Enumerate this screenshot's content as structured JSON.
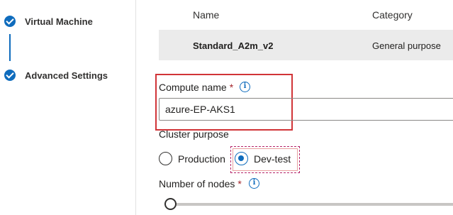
{
  "wizard": {
    "steps": [
      {
        "label": "Virtual Machine",
        "status": "complete"
      },
      {
        "label": "Advanced Settings",
        "status": "complete"
      }
    ]
  },
  "vm_table": {
    "columns": [
      "Name",
      "Category"
    ],
    "rows": [
      {
        "name": "Standard_A2m_v2",
        "category": "General purpose"
      }
    ]
  },
  "form": {
    "compute_name": {
      "label": "Compute name",
      "required_marker": "*",
      "value": "azure-EP-AKS1",
      "info_icon": "info-icon"
    },
    "cluster_purpose": {
      "label": "Cluster purpose",
      "options": [
        "Production",
        "Dev-test"
      ],
      "selected": "Dev-test"
    },
    "number_of_nodes": {
      "label": "Number of nodes",
      "required_marker": "*",
      "info_icon": "info-icon",
      "slider_value_fraction": 0
    }
  },
  "colors": {
    "accent": "#0f6cbd",
    "highlight": "#d13438",
    "required": "#a4262c",
    "selected_row": "#ebebeb"
  }
}
